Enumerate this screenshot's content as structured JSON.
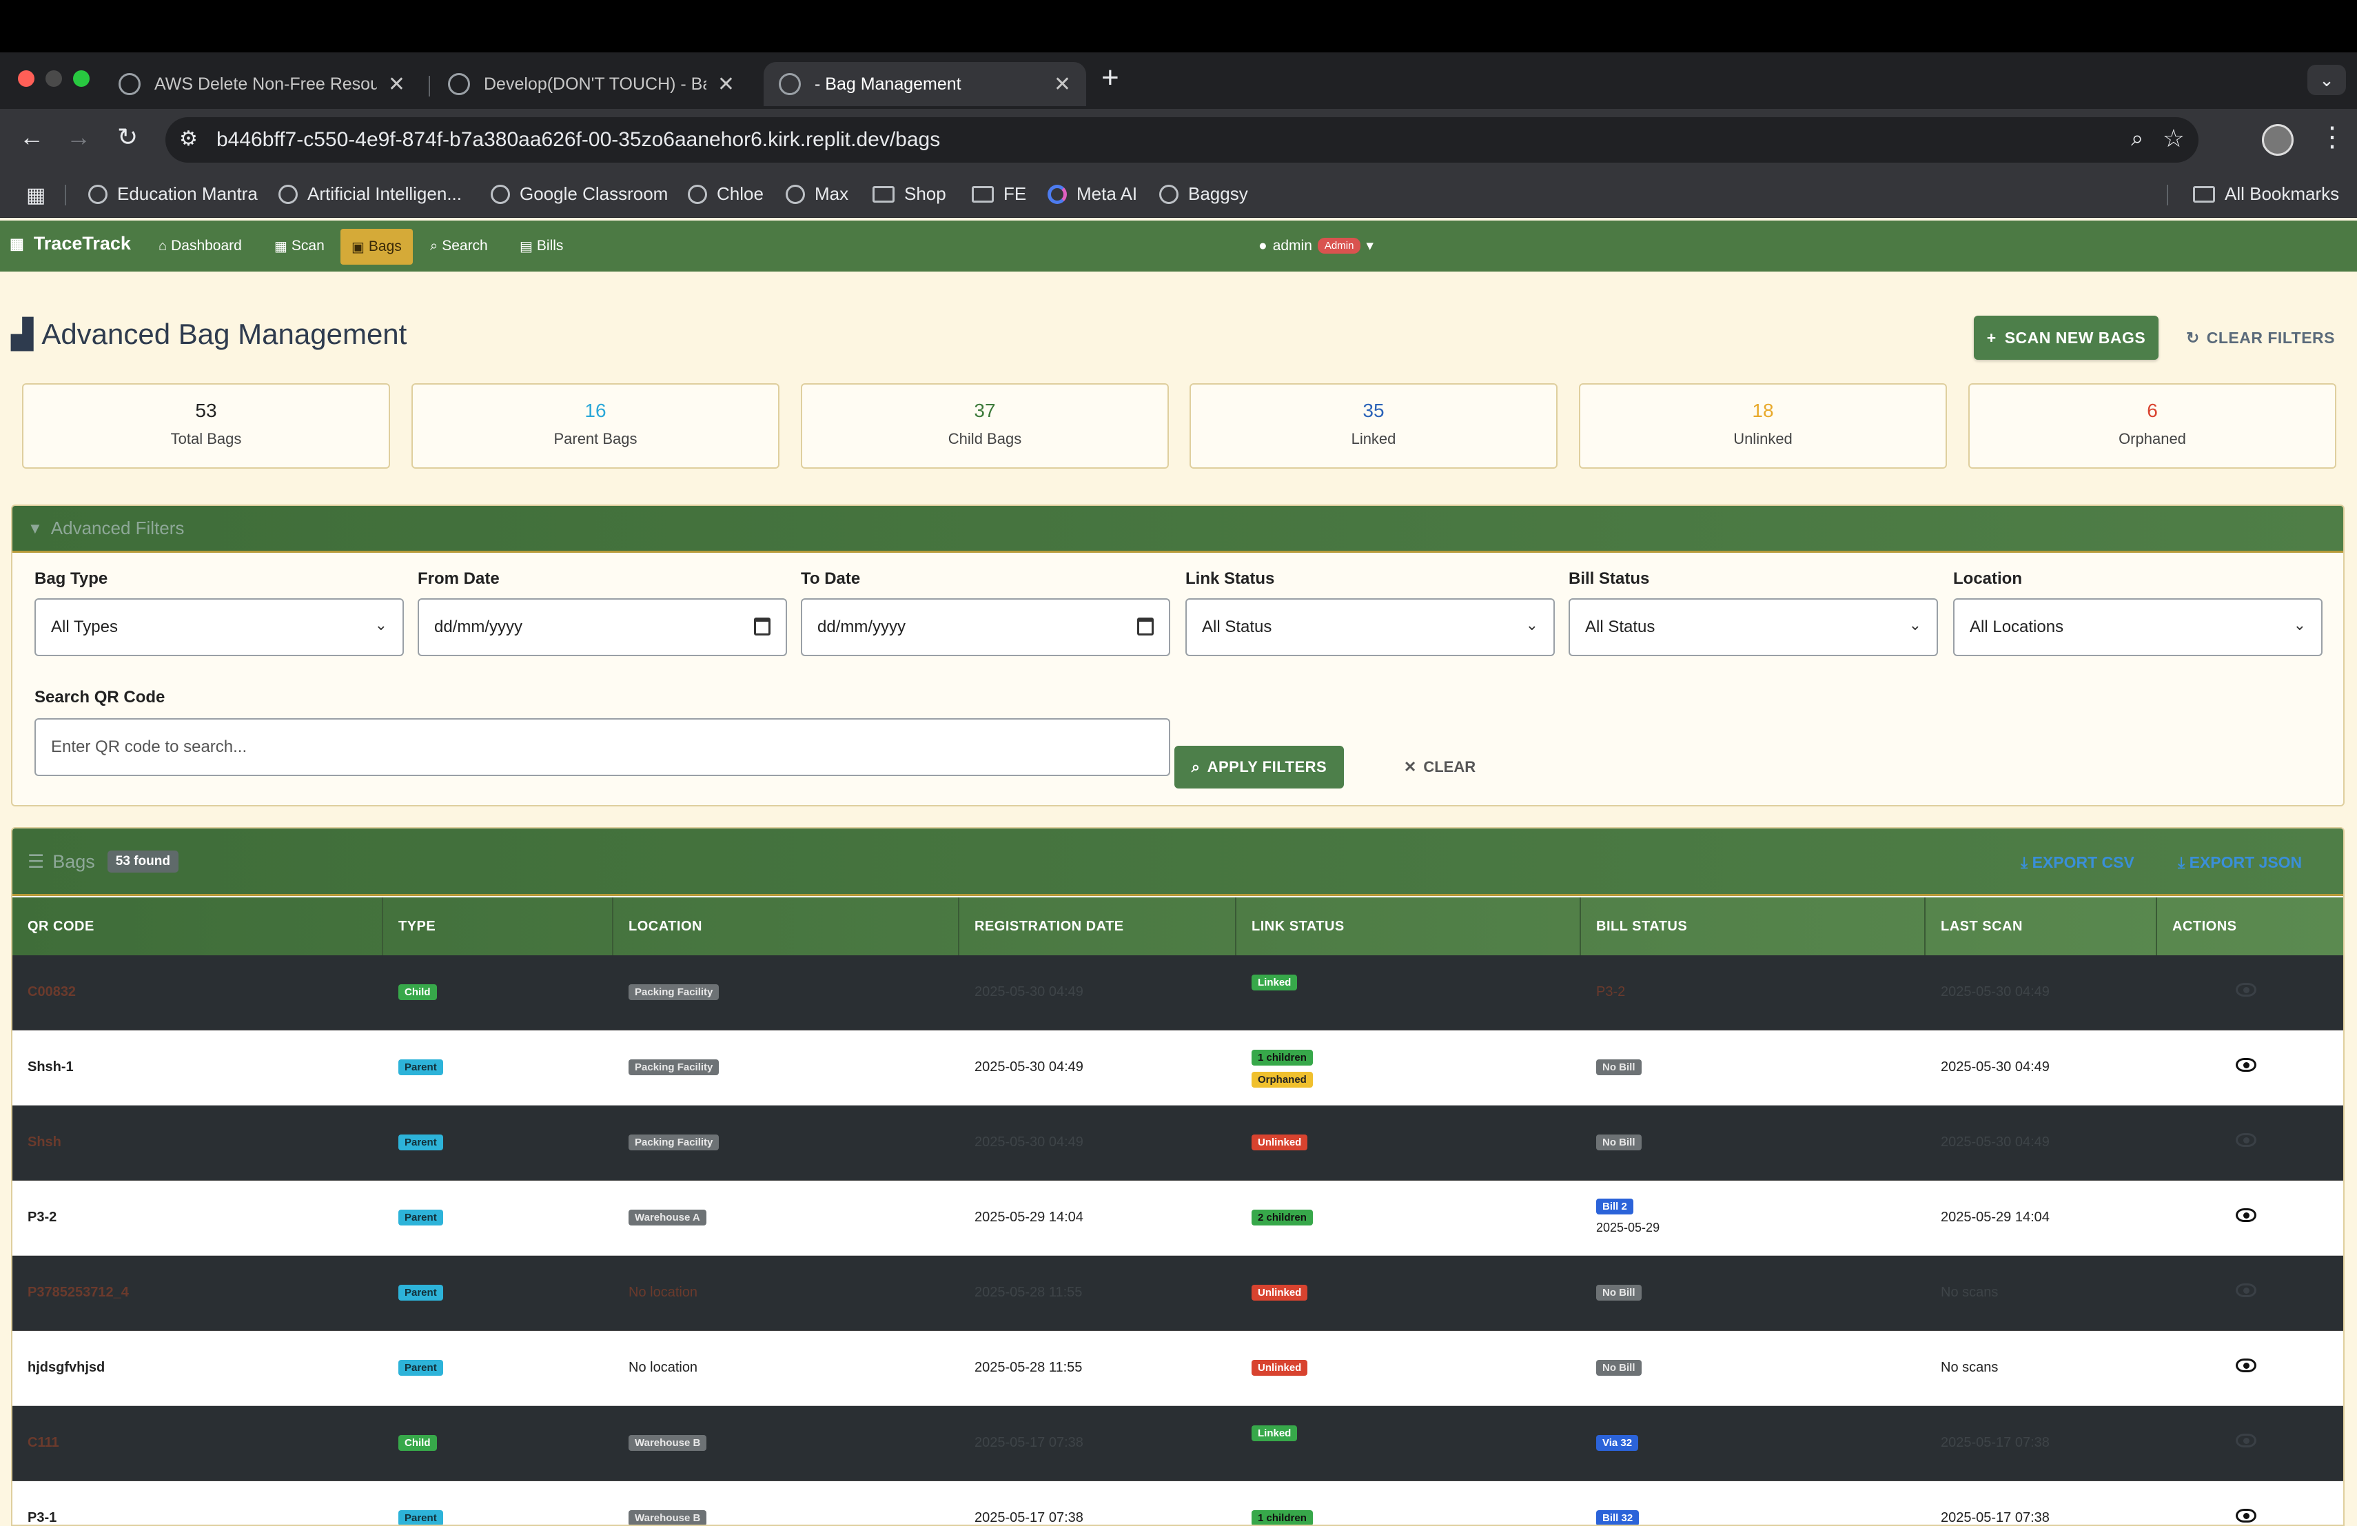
{
  "browser": {
    "tabs": [
      {
        "title": "AWS Delete Non-Free Resour"
      },
      {
        "title": "Develop(DON'T TOUCH) - Ba"
      },
      {
        "title": "- Bag Management"
      }
    ],
    "url": "b446bff7-c550-4e9f-874f-b7a380aa626f-00-35zo6aanehor6.kirk.replit.dev/bags",
    "bookmarks": [
      "Education Mantra",
      "Artificial Intelligen...",
      "Google Classroom",
      "Chloe",
      "Max",
      "Shop",
      "FE",
      "Meta AI",
      "Baggsy"
    ],
    "all_bookmarks": "All Bookmarks"
  },
  "nav": {
    "brand": "TraceTrack",
    "links": [
      "Dashboard",
      "Scan",
      "Bags",
      "Search",
      "Bills"
    ],
    "user": "admin",
    "role": "Admin"
  },
  "page": {
    "title": "Advanced Bag Management",
    "scan_button": "SCAN NEW BAGS",
    "clear_filters_button": "CLEAR FILTERS"
  },
  "stats": [
    {
      "value": "53",
      "label": "Total Bags",
      "color": "#222222"
    },
    {
      "value": "16",
      "label": "Parent Bags",
      "color": "#2aa7d8"
    },
    {
      "value": "37",
      "label": "Child Bags",
      "color": "#3d7a3a"
    },
    {
      "value": "35",
      "label": "Linked",
      "color": "#2b63b8"
    },
    {
      "value": "18",
      "label": "Unlinked",
      "color": "#e8a92a"
    },
    {
      "value": "6",
      "label": "Orphaned",
      "color": "#d9432f"
    }
  ],
  "filters": {
    "header": "Advanced Filters",
    "bag_type": {
      "label": "Bag Type",
      "value": "All Types"
    },
    "from_date": {
      "label": "From Date",
      "value": "dd/mm/yyyy"
    },
    "to_date": {
      "label": "To Date",
      "value": "dd/mm/yyyy"
    },
    "link_status": {
      "label": "Link Status",
      "value": "All Status"
    },
    "bill_status": {
      "label": "Bill Status",
      "value": "All Status"
    },
    "location": {
      "label": "Location",
      "value": "All Locations"
    },
    "search": {
      "label": "Search QR Code",
      "placeholder": "Enter QR code to search..."
    },
    "apply_button": "APPLY FILTERS",
    "clear_button": "CLEAR"
  },
  "bags": {
    "header": "Bags",
    "found": "53 found",
    "export_csv": "EXPORT CSV",
    "export_json": "EXPORT JSON",
    "columns": [
      "QR CODE",
      "TYPE",
      "LOCATION",
      "REGISTRATION DATE",
      "LINK STATUS",
      "BILL STATUS",
      "LAST SCAN",
      "ACTIONS"
    ],
    "rows": [
      {
        "qr": "C00832",
        "type": "Child",
        "location": "Packing Facility",
        "reg_date": "2025-05-30 04:49",
        "link": [
          "Linked"
        ],
        "bill": "P3-2",
        "bill_date": "",
        "last_scan": "2025-05-30 04:49",
        "dark": true
      },
      {
        "qr": "Shsh-1",
        "type": "Parent",
        "location": "Packing Facility",
        "reg_date": "2025-05-30 04:49",
        "link": [
          "1 children",
          "Orphaned"
        ],
        "bill": "No Bill",
        "bill_date": "",
        "last_scan": "2025-05-30 04:49",
        "dark": false
      },
      {
        "qr": "Shsh",
        "type": "Parent",
        "location": "Packing Facility",
        "reg_date": "2025-05-30 04:49",
        "link": [
          "Unlinked"
        ],
        "bill": "No Bill",
        "bill_date": "",
        "last_scan": "2025-05-30 04:49",
        "dark": true
      },
      {
        "qr": "P3-2",
        "type": "Parent",
        "location": "Warehouse A",
        "reg_date": "2025-05-29 14:04",
        "link": [
          "2 children"
        ],
        "bill": "Bill 2",
        "bill_date": "2025-05-29",
        "last_scan": "2025-05-29 14:04",
        "dark": false
      },
      {
        "qr": "P3785253712_4",
        "type": "Parent",
        "location": "No location",
        "reg_date": "2025-05-28 11:55",
        "link": [
          "Unlinked"
        ],
        "bill": "No Bill",
        "bill_date": "",
        "last_scan": "No scans",
        "dark": true
      },
      {
        "qr": "hjdsgfvhjsd",
        "type": "Parent",
        "location": "No location",
        "reg_date": "2025-05-28 11:55",
        "link": [
          "Unlinked"
        ],
        "bill": "No Bill",
        "bill_date": "",
        "last_scan": "No scans",
        "dark": false
      },
      {
        "qr": "C111",
        "type": "Child",
        "location": "Warehouse B",
        "reg_date": "2025-05-17 07:38",
        "link": [
          "Linked"
        ],
        "bill": "Via 32",
        "bill_date": "",
        "last_scan": "2025-05-17 07:38",
        "dark": true
      },
      {
        "qr": "P3-1",
        "type": "Parent",
        "location": "Warehouse B",
        "reg_date": "2025-05-17 07:38",
        "link": [
          "1 children"
        ],
        "bill": "Bill 32",
        "bill_date": "",
        "last_scan": "2025-05-17 07:38",
        "dark": false
      }
    ]
  }
}
